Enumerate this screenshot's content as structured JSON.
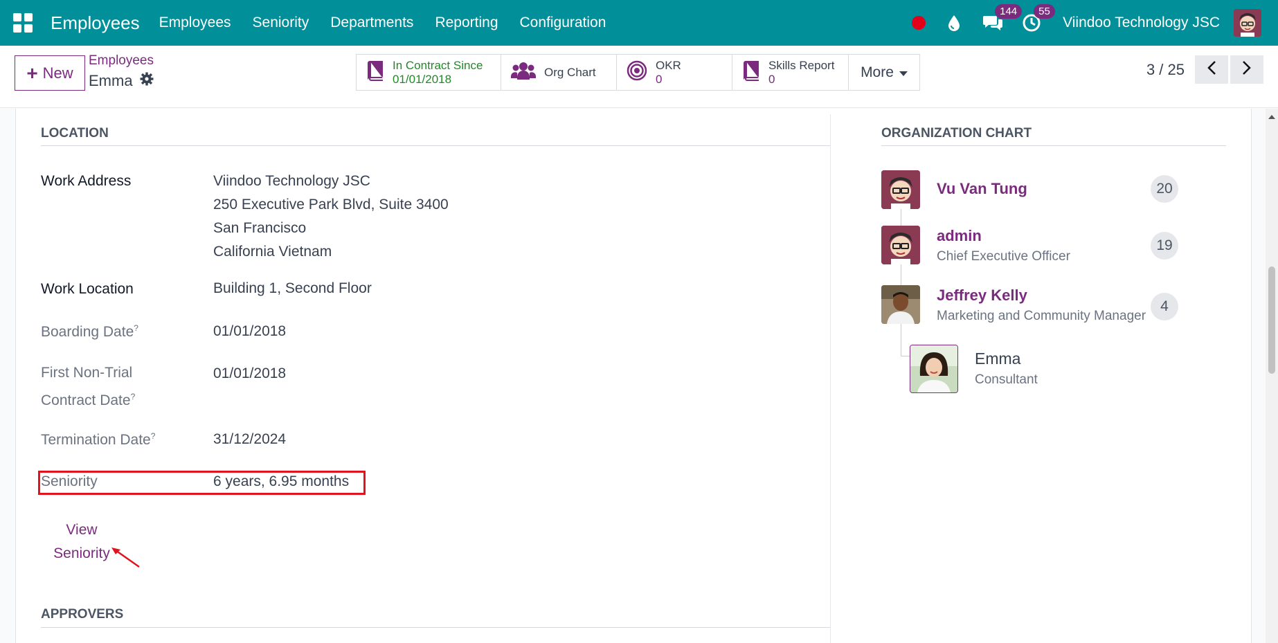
{
  "navbar": {
    "brand": "Employees",
    "menu": [
      "Employees",
      "Seniority",
      "Departments",
      "Reporting",
      "Configuration"
    ],
    "messages_count": "144",
    "activities_count": "55",
    "company": "Viindoo Technology JSC"
  },
  "control": {
    "new_label": "New",
    "breadcrumb_parent": "Employees",
    "breadcrumb_current": "Emma",
    "smart_buttons": {
      "contract_label": "In Contract Since",
      "contract_value": "01/01/2018",
      "org_chart_label": "Org Chart",
      "okr_label": "OKR",
      "okr_value": "0",
      "skills_label": "Skills Report",
      "skills_value": "0",
      "more_label": "More"
    },
    "pager": "3 / 25"
  },
  "location": {
    "title": "LOCATION",
    "work_address_label": "Work Address",
    "work_address": [
      "Viindoo Technology JSC",
      "250 Executive Park Blvd, Suite 3400",
      "San Francisco",
      "California Vietnam"
    ],
    "work_location_label": "Work Location",
    "work_location": "Building 1, Second Floor",
    "boarding_date_label": "Boarding Date",
    "boarding_date": "01/01/2018",
    "first_contract_label_1": "First Non-Trial",
    "first_contract_label_2": "Contract Date",
    "first_contract_date": "01/01/2018",
    "termination_label": "Termination Date",
    "termination_date": "31/12/2024",
    "help_mark": "?",
    "seniority_label": "Seniority",
    "seniority_value": "6 years, 6.95 months",
    "view_seniority_1": "View",
    "view_seniority_2": "Seniority"
  },
  "approvers": {
    "title": "APPROVERS"
  },
  "org_chart": {
    "title": "ORGANIZATION CHART",
    "managers": [
      {
        "name": "Vu Van Tung",
        "job": "",
        "count": "20"
      },
      {
        "name": "admin",
        "job": "Chief Executive Officer",
        "count": "19"
      },
      {
        "name": "Jeffrey Kelly",
        "job": "Marketing and Community Manager",
        "count": "4"
      }
    ],
    "self": {
      "name": "Emma",
      "job": "Consultant"
    }
  },
  "colors": {
    "navbar": "#018f9a",
    "accent": "#7a2b7e",
    "highlight": "#e0141e",
    "success": "#1e8a24"
  }
}
